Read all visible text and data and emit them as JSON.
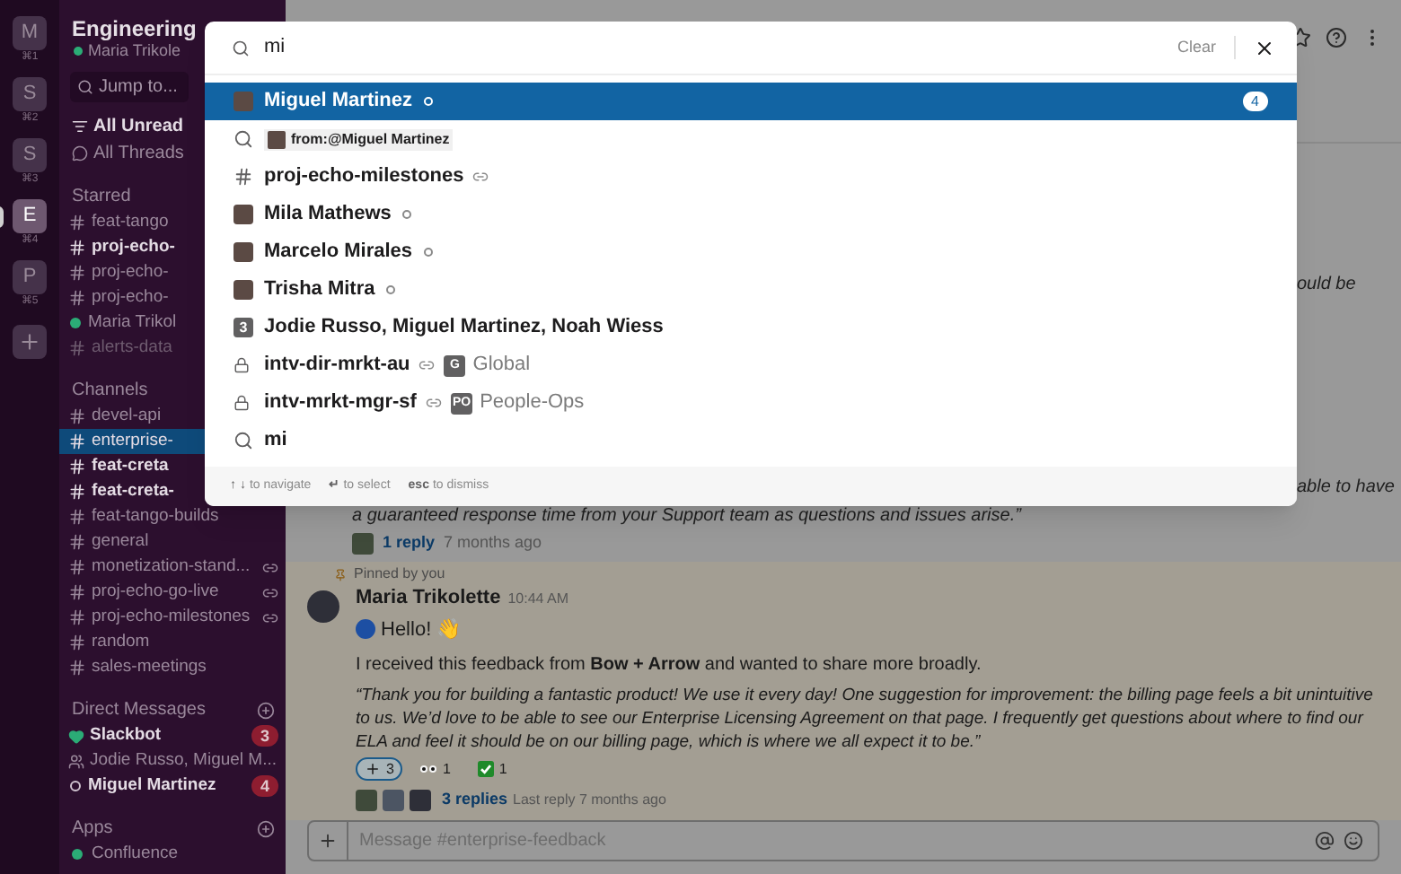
{
  "rail": [
    {
      "initial": "M",
      "shortcut": "⌘1",
      "selected": false
    },
    {
      "initial": "S",
      "shortcut": "⌘2",
      "selected": false
    },
    {
      "initial": "S",
      "shortcut": "⌘3",
      "selected": false
    },
    {
      "initial": "E",
      "shortcut": "⌘4",
      "selected": true
    },
    {
      "initial": "P",
      "shortcut": "⌘5",
      "selected": false
    }
  ],
  "sidebar": {
    "workspace": "Engineering",
    "user": "Maria Trikole",
    "jump": "Jump to...",
    "nav": [
      {
        "label": "All Unread",
        "kind": "unread"
      },
      {
        "label": "All Threads",
        "kind": "threads"
      }
    ],
    "sections": [
      {
        "title": "Starred",
        "add": false,
        "items": [
          {
            "label": "feat-tango",
            "kind": "channel",
            "bold": false,
            "selected": false,
            "muted": false
          },
          {
            "label": "proj-echo-",
            "kind": "channel",
            "bold": true,
            "selected": false,
            "muted": false
          },
          {
            "label": "proj-echo-",
            "kind": "channel",
            "bold": false,
            "selected": false,
            "muted": false
          },
          {
            "label": "proj-echo-",
            "kind": "channel",
            "bold": false,
            "selected": false,
            "muted": false
          },
          {
            "label": "Maria Trikol",
            "kind": "dm",
            "active": true,
            "bold": false,
            "selected": false,
            "muted": false
          },
          {
            "label": "alerts-data",
            "kind": "channel",
            "bold": false,
            "selected": false,
            "muted": true
          }
        ]
      },
      {
        "title": "Channels",
        "add": false,
        "items": [
          {
            "label": "devel-api",
            "kind": "channel",
            "bold": false,
            "selected": false,
            "muted": false
          },
          {
            "label": "enterprise-",
            "kind": "channel",
            "bold": false,
            "selected": true,
            "muted": false
          },
          {
            "label": "feat-creta",
            "kind": "channel",
            "bold": true,
            "selected": false,
            "muted": false
          },
          {
            "label": "feat-creta-",
            "kind": "channel",
            "bold": true,
            "selected": false,
            "muted": false
          },
          {
            "label": "feat-tango-builds",
            "kind": "channel",
            "bold": false,
            "selected": false,
            "muted": false
          },
          {
            "label": "general",
            "kind": "channel",
            "bold": false,
            "selected": false,
            "muted": false
          },
          {
            "label": "monetization-stand...",
            "kind": "channel",
            "shared": true,
            "bold": false,
            "selected": false,
            "muted": false
          },
          {
            "label": "proj-echo-go-live",
            "kind": "channel",
            "shared": true,
            "bold": false,
            "selected": false,
            "muted": false
          },
          {
            "label": "proj-echo-milestones",
            "kind": "channel",
            "shared": true,
            "bold": false,
            "selected": false,
            "muted": false
          },
          {
            "label": "random",
            "kind": "channel",
            "bold": false,
            "selected": false,
            "muted": false
          },
          {
            "label": "sales-meetings",
            "kind": "channel",
            "bold": false,
            "selected": false,
            "muted": false
          }
        ]
      },
      {
        "title": "Direct Messages",
        "add": true,
        "items": [
          {
            "label": "Slackbot",
            "kind": "bot",
            "bold": true,
            "badge": "3",
            "selected": false,
            "muted": false
          },
          {
            "label": "Jodie Russo, Miguel M...",
            "kind": "group",
            "bold": false,
            "selected": false,
            "muted": false
          },
          {
            "label": "Miguel Martinez",
            "kind": "dm",
            "active": false,
            "bold": true,
            "badge": "4",
            "selected": false,
            "muted": false
          }
        ]
      },
      {
        "title": "Apps",
        "add": true,
        "items": [
          {
            "label": "Confluence",
            "kind": "app",
            "bold": false,
            "selected": false,
            "muted": false
          }
        ]
      }
    ]
  },
  "main": {
    "fragments": [
      "ould be",
      "able to have"
    ],
    "earlier": {
      "text": "a guaranteed response time from your Support team as questions and issues arise.”",
      "replies": "1 reply",
      "time": "7 months ago"
    },
    "pinned": {
      "label": "Pinned by you",
      "author": "Maria Trikolette",
      "time": "10:44 AM",
      "greeting": "Hello! 👋",
      "body": "I received this feedback from **Bow + Arrow** and wanted to share more broadly.",
      "quote": "“Thank you for building a fantastic product! We use it every day! One suggestion for improvement: the billing page feels a bit unintuitive to us. We’d love to be able to see our Enterprise Licensing Agreement on that page. I frequently get questions about where to find our ELA and feel it should be on our billing page, which is where we all expect it to be.”",
      "reactions": [
        {
          "kind": "plus",
          "count": "3",
          "selected": true
        },
        {
          "kind": "eyes",
          "count": "1",
          "selected": false
        },
        {
          "kind": "check",
          "count": "1",
          "selected": false
        }
      ],
      "replies": "3 replies",
      "last_reply": "Last reply 7 months ago"
    },
    "composer": {
      "placeholder": "Message #enterprise-feedback"
    }
  },
  "search": {
    "query": "mi",
    "clear": "Clear",
    "results": [
      {
        "kind": "person",
        "label": "Miguel Martinez",
        "badge": "4",
        "selected": true
      },
      {
        "kind": "from",
        "label": "from:@Miguel Martinez",
        "selected": false
      },
      {
        "kind": "channel",
        "label": "proj-echo-milestones",
        "shared": true,
        "selected": false
      },
      {
        "kind": "person",
        "label": "Mila Mathews",
        "selected": false
      },
      {
        "kind": "person",
        "label": "Marcelo Mirales",
        "selected": false
      },
      {
        "kind": "person",
        "label": "Trisha Mitra",
        "selected": false
      },
      {
        "kind": "group",
        "count": "3",
        "label": "Jodie Russo, Miguel Martinez, Noah Wiess",
        "selected": false
      },
      {
        "kind": "private",
        "label": "intv-dir-mrkt-au",
        "shared": true,
        "org_initial": "G",
        "org": "Global",
        "selected": false
      },
      {
        "kind": "private",
        "label": "intv-mrkt-mgr-sf",
        "shared": true,
        "org_initial": "PO",
        "org": "People-Ops",
        "selected": false
      },
      {
        "kind": "query",
        "label": "mi",
        "selected": false
      }
    ],
    "hints": [
      {
        "key": "↑ ↓",
        "text": "to navigate"
      },
      {
        "key": "↵",
        "text": "to select"
      },
      {
        "key": "esc",
        "text": "to dismiss"
      }
    ]
  }
}
